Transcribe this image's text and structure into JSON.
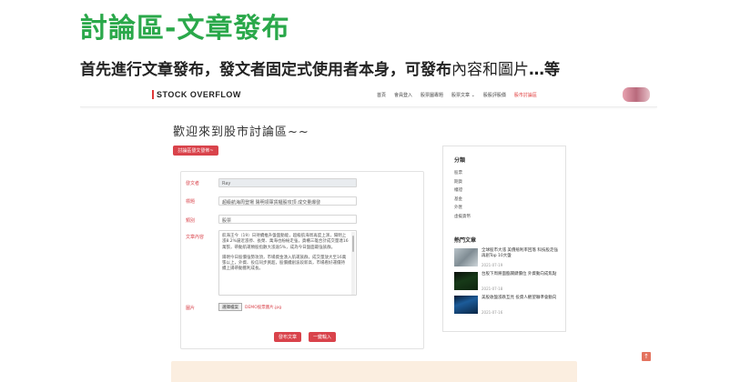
{
  "slide": {
    "title": "討論區-文章發布",
    "subtitle_bold": "首先進行文章發布，發文者固定式使用者本身，可發布",
    "subtitle_light": "內容和圖片",
    "subtitle_end": "…等"
  },
  "navbar": {
    "brand": "STOCK OVERFLOW",
    "items": [
      "首頁",
      "會員登入",
      "股票圖專題",
      "股票文章 ⌄",
      "股股評股價",
      "股市討論區"
    ],
    "active_index": 5
  },
  "main": {
    "heading": "歡迎來到股市討論區~~",
    "list_button": "討論區發文發佈~",
    "form": {
      "author_label": "發文者",
      "author_value": "Ray",
      "title_label": "標題",
      "title_value": "超級航海周登場 陽明領軍貨櫃股攻頂 成交量爆發",
      "category_label": "類別",
      "category_value": "股票",
      "content_label": "文章內容",
      "content_p1": "航海王今（19）日持續推升盤面動能，超級航海周再度上演，陽明上漲8.2%逼近漲停、長榮、萬海也紛紛走強，貨櫃三雄合計成交量達16萬張，帶動航運類股指數大漲逾5%，成為今日盤面最強族群。",
      "content_p2": "陽明今日股價強勢攻頂，市場資金湧入航運族群，成交量放大至16萬張以上，外資、投信同步買超，股價續創波段新高，市場看好運價持續上揚帶動獲利成長。",
      "image_label": "圖片",
      "file_button": "選擇檔案",
      "file_name": "DEMO股票圖片.jpg",
      "submit_button": "發布文章",
      "reset_button": "一鍵輸入"
    }
  },
  "sidebar": {
    "categories_title": "分類",
    "categories": [
      "股票",
      "期貨",
      "權證",
      "基金",
      "外匯",
      "虛擬貨幣"
    ],
    "popular_title": "熱門文章",
    "posts": [
      {
        "title": "全球股市大漲 美債殖利率回落 科技股走強再創Top 10大盤",
        "date": "2021-07-19"
      },
      {
        "title": "台股下周將面臨關鍵價位 外資動向成焦點",
        "date": "2021-07-18"
      },
      {
        "title": "美股收盤漲跌互見 投資人觀望聯準會動向",
        "date": "2021-07-16"
      }
    ]
  },
  "to_top": "↑"
}
